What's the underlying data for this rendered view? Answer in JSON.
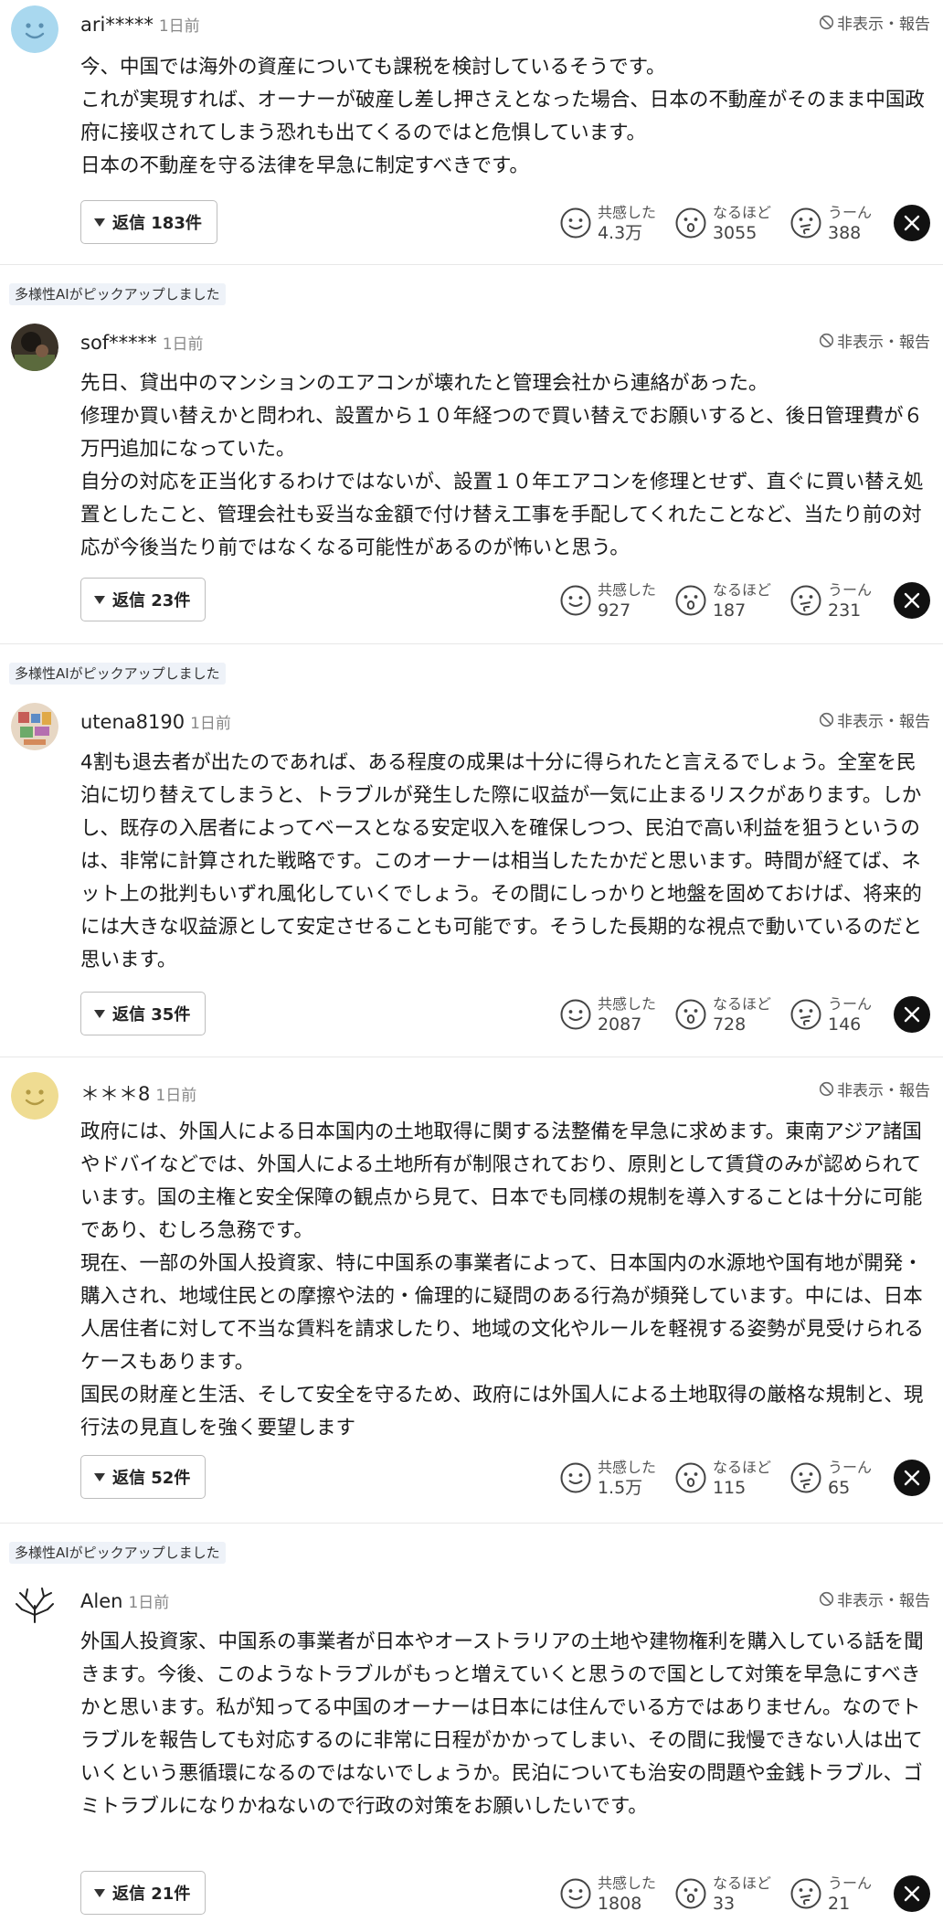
{
  "ui": {
    "hide_report": "非表示・報告",
    "reaction_labels": {
      "empathy": "共感した",
      "insight": "なるほど",
      "hmm": "うーん"
    },
    "ai_pick_label": "多様性AIがピックアップしました"
  },
  "comments": [
    {
      "user": "ari*****",
      "time": "1日前",
      "avatar": "blue-smiley",
      "ai_pick": false,
      "body": "今、中国では海外の資産についても課税を検討しているそうです。\nこれが実現すれば、オーナーが破産し差し押さえとなった場合、日本の不動産がそのまま中国政府に接収されてしまう恐れも出てくるのではと危惧しています。\n日本の不動産を守る法律を早急に制定すべきです。",
      "replies": "返信 183件",
      "empathy": "4.3万",
      "insight": "3055",
      "hmm": "388"
    },
    {
      "user": "sof*****",
      "time": "1日前",
      "avatar": "dark-photo",
      "ai_pick": true,
      "body": "先日、貸出中のマンションのエアコンが壊れたと管理会社から連絡があった。\n修理か買い替えかと問われ、設置から１０年経つので買い替えでお願いすると、後日管理費が６万円追加になっていた。\n自分の対応を正当化するわけではないが、設置１０年エアコンを修理とせず、直ぐに買い替え処置としたこと、管理会社も妥当な金額で付け替え工事を手配してくれたことなど、当たり前の対応が今後当たり前ではなくなる可能性があるのが怖いと思う。",
      "replies": "返信 23件",
      "empathy": "927",
      "insight": "187",
      "hmm": "231"
    },
    {
      "user": "utena8190",
      "time": "1日前",
      "avatar": "colorful-photo",
      "ai_pick": true,
      "body": "4割も退去者が出たのであれば、ある程度の成果は十分に得られたと言えるでしょう。全室を民泊に切り替えてしまうと、トラブルが発生した際に収益が一気に止まるリスクがあります。しかし、既存の入居者によってベースとなる安定収入を確保しつつ、民泊で高い利益を狙うというのは、非常に計算された戦略です。このオーナーは相当したたかだと思います。時間が経てば、ネット上の批判もいずれ風化していくでしょう。その間にしっかりと地盤を固めておけば、将来的には大きな収益源として安定させることも可能です。そうした長期的な視点で動いているのだと思います。",
      "replies": "返信 35件",
      "empathy": "2087",
      "insight": "728",
      "hmm": "146"
    },
    {
      "user": "＊＊＊8",
      "time": "1日前",
      "avatar": "yellow-smiley",
      "ai_pick": false,
      "body": "政府には、外国人による日本国内の土地取得に関する法整備を早急に求めます。東南アジア諸国やドバイなどでは、外国人による土地所有が制限されており、原則として賃貸のみが認められています。国の主権と安全保障の観点から見て、日本でも同様の規制を導入することは十分に可能であり、むしろ急務です。\n現在、一部の外国人投資家、特に中国系の事業者によって、日本国内の水源地や国有地が開発・購入され、地域住民との摩擦や法的・倫理的に疑問のある行為が頻発しています。中には、日本人居住者に対して不当な賃料を請求したり、地域の文化やルールを軽視する姿勢が見受けられるケースもあります。\n国民の財産と生活、そして安全を守るため、政府には外国人による土地取得の厳格な規制と、現行法の見直しを強く要望します",
      "replies": "返信 52件",
      "empathy": "1.5万",
      "insight": "115",
      "hmm": "65"
    },
    {
      "user": "Alen",
      "time": "1日前",
      "avatar": "coral-drawing",
      "ai_pick": true,
      "body": "外国人投資家、中国系の事業者が日本やオーストラリアの土地や建物権利を購入している話を聞きます。今後、このようなトラブルがもっと増えていくと思うので国として対策を早急にすべきかと思います。私が知ってる中国のオーナーは日本には住んでいる方ではありません。なのでトラブルを報告しても対応するのに非常に日程がかかってしまい、その間に我慢できない人は出ていくという悪循環になるのではないでしょうか。民泊についても治安の問題や金銭トラブル、ゴミトラブルになりかねないので行政の対策をお願いしたいです。",
      "replies": "返信 21件",
      "empathy": "1808",
      "insight": "33",
      "hmm": "21"
    }
  ]
}
